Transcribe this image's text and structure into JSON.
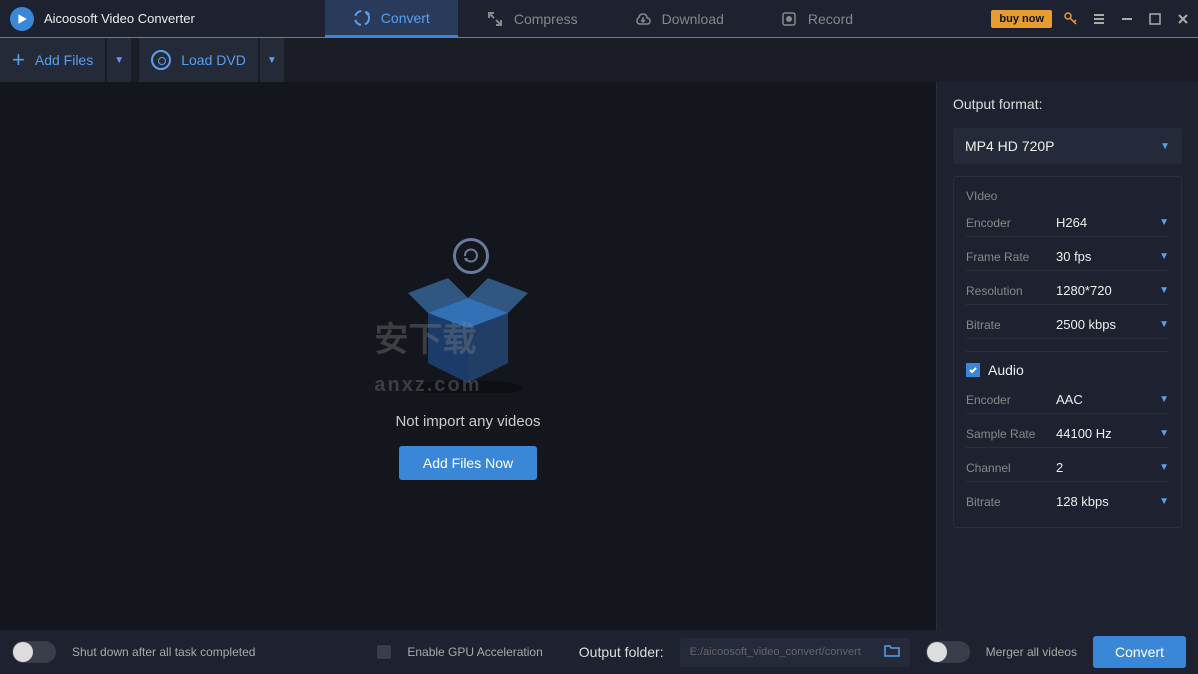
{
  "app": {
    "title": "Aicoosoft Video Converter"
  },
  "tabs": {
    "convert": "Convert",
    "compress": "Compress",
    "download": "Download",
    "record": "Record"
  },
  "titlebar": {
    "buy_now": "buy now"
  },
  "toolbar": {
    "add_files": "Add Files",
    "load_dvd": "Load DVD"
  },
  "empty": {
    "text": "Not import any videos",
    "button": "Add Files Now",
    "watermark": "安下载"
  },
  "sidebar": {
    "output_label": "Output format:",
    "format": "MP4 HD 720P",
    "video_label": "VIdeo",
    "audio_label": "Audio",
    "encoder_label": "Encoder",
    "framerate_label": "Frame Rate",
    "resolution_label": "Resolution",
    "bitrate_label": "Bitrate",
    "samplerate_label": "Sample Rate",
    "channel_label": "Channel",
    "video": {
      "encoder": "H264",
      "framerate": "30 fps",
      "resolution": "1280*720",
      "bitrate": "2500 kbps"
    },
    "audio": {
      "encoder": "AAC",
      "samplerate": "44100 Hz",
      "channel": "2",
      "bitrate": "128 kbps"
    }
  },
  "footer": {
    "shutdown": "Shut down after all task completed",
    "gpu": "Enable GPU Acceleration",
    "output_folder_label": "Output folder:",
    "output_folder_placeholder": "E:/aicoosoft_video_convert/convert",
    "merger": "Merger all videos",
    "convert": "Convert"
  }
}
